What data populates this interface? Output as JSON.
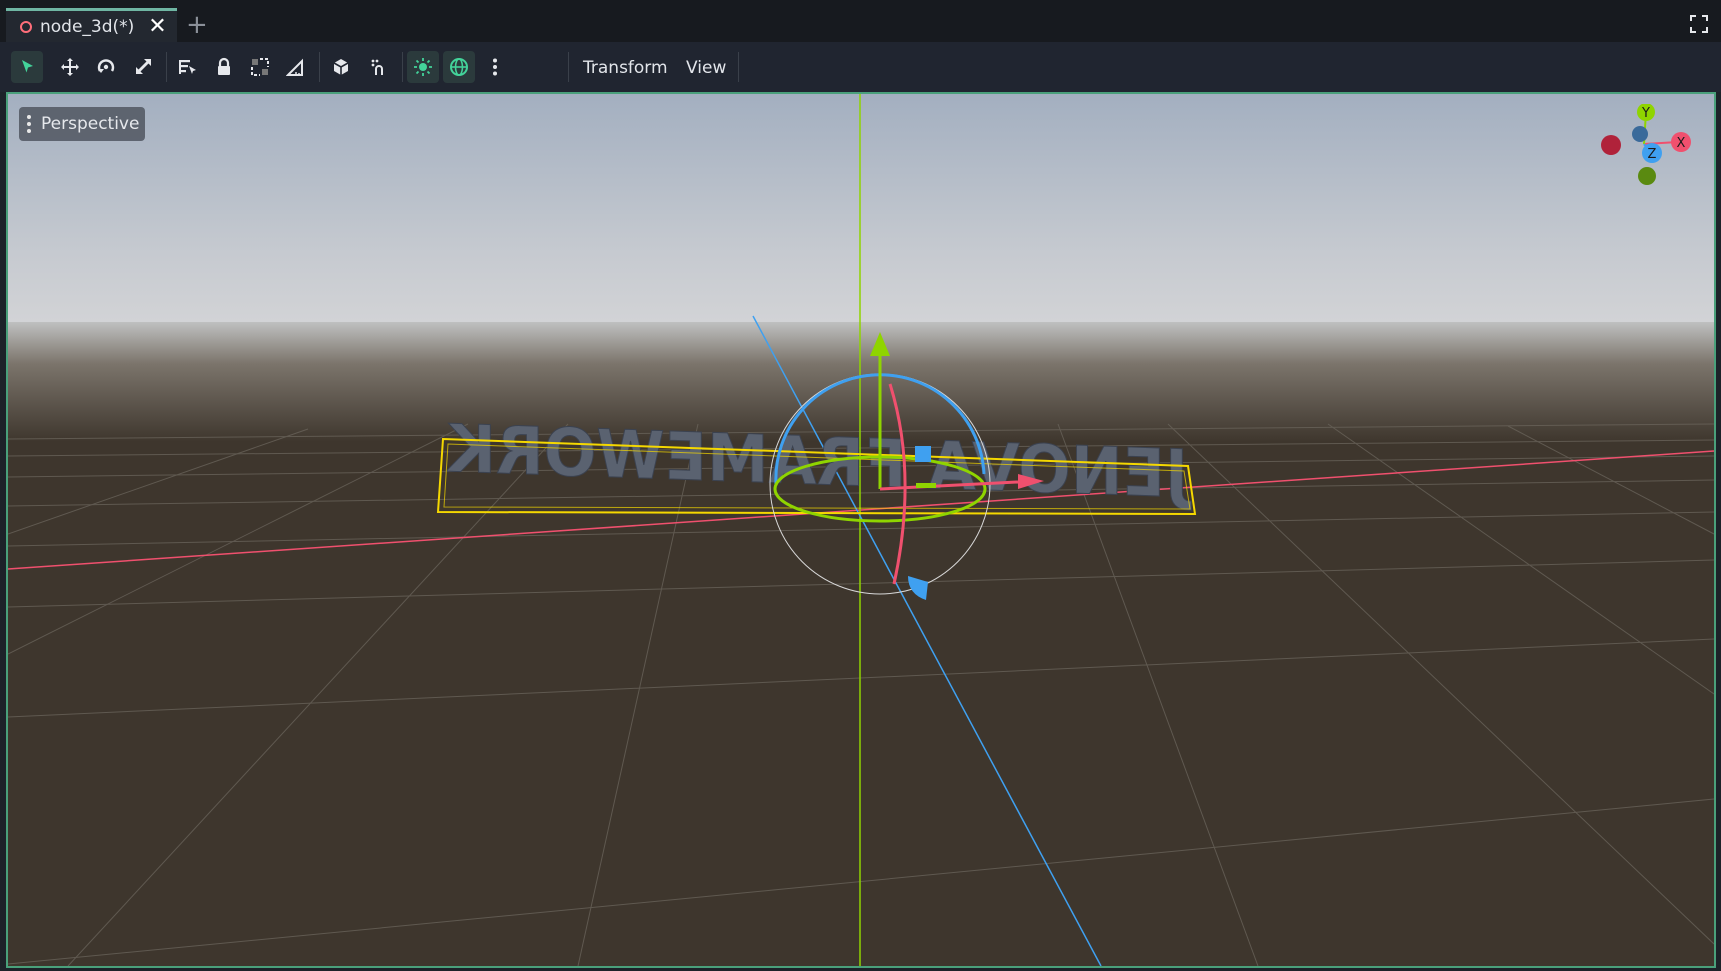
{
  "tab": {
    "title": "node_3d(*)",
    "close_glyph": "✕",
    "add_glyph": "+"
  },
  "toolbar": {
    "tools": [
      {
        "name": "select-tool-icon",
        "active": true
      },
      {
        "name": "move-tool-icon"
      },
      {
        "name": "rotate-tool-icon"
      },
      {
        "name": "scale-tool-icon"
      },
      {
        "name": "list-select-icon"
      },
      {
        "name": "lock-icon"
      },
      {
        "name": "group-icon"
      },
      {
        "name": "ruler-icon"
      },
      {
        "name": "local-space-icon"
      },
      {
        "name": "snap-icon"
      },
      {
        "name": "sun-toggle-icon",
        "active": true
      },
      {
        "name": "environment-toggle-icon",
        "active": true
      },
      {
        "name": "more-icon"
      }
    ],
    "menu_transform": "Transform",
    "menu_view": "View"
  },
  "viewport": {
    "perspective_label": "Perspective",
    "gizmo": {
      "x": "X",
      "y": "Y",
      "z": "Z"
    },
    "scene_text": "JENOVA FRAMEWORK"
  },
  "colors": {
    "accent": "#4aa07b",
    "x_axis": "#f0506e",
    "y_axis": "#8fd400",
    "z_axis": "#3fa0f0",
    "selection": "#f5d800",
    "ground": "#3e362d"
  }
}
